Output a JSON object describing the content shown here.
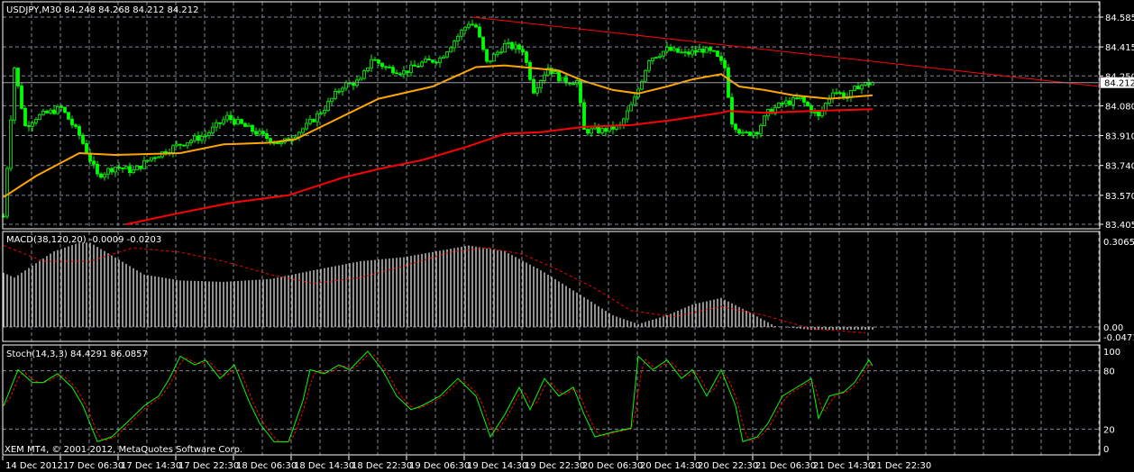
{
  "header": {
    "symbol_label": "USDJPY,M30  84.248 84.268 84.212 84.212",
    "macd_label": "MACD(38,120,20) -0.0009 -0.0203",
    "stoch_label": "Stoch(14,3,3) 84.4291 86.0857",
    "copyright": "XEM MT4, © 2001-2012, MetaQuotes Software Corp."
  },
  "colors": {
    "candle": "#00ff00",
    "ma_fast": "#ffa500",
    "ma_slow": "#ff0000",
    "trendline": "#ff0000",
    "macd_hist": "#c0c0c0",
    "macd_signal": "#ff0000",
    "stoch_main": "#00ff00",
    "stoch_signal": "#ff0000",
    "grid": "#7f8a99"
  },
  "chart_data": {
    "type": "line",
    "title": "USDJPY,M30",
    "x_unit": "bar index (30 min bars)",
    "time_ticks": [
      {
        "bar": 0,
        "label": "14 Dec 2012"
      },
      {
        "bar": 16,
        "label": "17 Dec 06:30"
      },
      {
        "bar": 32,
        "label": "17 Dec 14:30"
      },
      {
        "bar": 48,
        "label": "17 Dec 22:30"
      },
      {
        "bar": 64,
        "label": "18 Dec 06:30"
      },
      {
        "bar": 80,
        "label": "18 Dec 14:30"
      },
      {
        "bar": 96,
        "label": "18 Dec 22:30"
      },
      {
        "bar": 112,
        "label": "19 Dec 06:30"
      },
      {
        "bar": 128,
        "label": "19 Dec 14:30"
      },
      {
        "bar": 144,
        "label": "19 Dec 22:30"
      },
      {
        "bar": 160,
        "label": "20 Dec 06:30"
      },
      {
        "bar": 176,
        "label": "20 Dec 14:30"
      },
      {
        "bar": 192,
        "label": "20 Dec 22:30"
      },
      {
        "bar": 208,
        "label": "21 Dec 06:30"
      },
      {
        "bar": 224,
        "label": "21 Dec 14:30"
      },
      {
        "bar": 240,
        "label": "21 Dec 22:30"
      }
    ],
    "price": {
      "ylim": [
        83.405,
        84.585
      ],
      "ticks": [
        "84.585",
        "84.415",
        "84.250",
        "84.080",
        "83.910",
        "83.740",
        "83.570",
        "83.405"
      ],
      "current": "84.212",
      "close_series": [
        [
          0,
          83.451
        ],
        [
          3,
          84.298
        ],
        [
          6,
          83.964
        ],
        [
          9,
          84.015
        ],
        [
          16,
          84.067
        ],
        [
          21,
          83.913
        ],
        [
          26,
          83.682
        ],
        [
          31,
          83.733
        ],
        [
          36,
          83.708
        ],
        [
          41,
          83.785
        ],
        [
          49,
          83.862
        ],
        [
          56,
          83.913
        ],
        [
          62,
          84.015
        ],
        [
          69,
          83.939
        ],
        [
          74,
          83.887
        ],
        [
          77,
          83.862
        ],
        [
          84,
          83.964
        ],
        [
          89,
          84.067
        ],
        [
          94,
          84.195
        ],
        [
          99,
          84.221
        ],
        [
          102,
          84.349
        ],
        [
          106,
          84.298
        ],
        [
          111,
          84.272
        ],
        [
          116,
          84.323
        ],
        [
          121,
          84.349
        ],
        [
          125,
          84.452
        ],
        [
          129,
          84.554
        ],
        [
          131,
          84.529
        ],
        [
          134,
          84.323
        ],
        [
          139,
          84.426
        ],
        [
          144,
          84.4
        ],
        [
          147,
          84.169
        ],
        [
          151,
          84.298
        ],
        [
          155,
          84.221
        ],
        [
          159,
          84.221
        ],
        [
          161,
          83.939
        ],
        [
          166,
          83.939
        ],
        [
          171,
          83.964
        ],
        [
          175,
          84.118
        ],
        [
          179,
          84.349
        ],
        [
          184,
          84.4
        ],
        [
          189,
          84.375
        ],
        [
          194,
          84.4
        ],
        [
          197,
          84.375
        ],
        [
          200,
          84.298
        ],
        [
          202,
          83.99
        ],
        [
          205,
          83.913
        ],
        [
          209,
          83.939
        ],
        [
          212,
          84.041
        ],
        [
          216,
          84.092
        ],
        [
          221,
          84.118
        ],
        [
          226,
          84.015
        ],
        [
          230,
          84.169
        ],
        [
          234,
          84.128
        ],
        [
          237,
          84.195
        ],
        [
          241,
          84.212
        ]
      ],
      "ma_fast": [
        [
          0,
          83.56
        ],
        [
          9,
          83.68
        ],
        [
          21,
          83.81
        ],
        [
          31,
          83.8
        ],
        [
          49,
          83.81
        ],
        [
          61,
          83.86
        ],
        [
          74,
          83.87
        ],
        [
          81,
          83.89
        ],
        [
          91,
          83.99
        ],
        [
          104,
          84.12
        ],
        [
          119,
          84.19
        ],
        [
          131,
          84.3
        ],
        [
          139,
          84.31
        ],
        [
          144,
          84.3
        ],
        [
          154,
          84.28
        ],
        [
          161,
          84.22
        ],
        [
          169,
          84.17
        ],
        [
          176,
          84.15
        ],
        [
          184,
          84.19
        ],
        [
          191,
          84.23
        ],
        [
          199,
          84.26
        ],
        [
          204,
          84.19
        ],
        [
          211,
          84.17
        ],
        [
          219,
          84.14
        ],
        [
          229,
          84.12
        ],
        [
          235,
          84.13
        ],
        [
          241,
          84.14
        ]
      ],
      "ma_slow": [
        [
          34,
          83.405
        ],
        [
          49,
          83.47
        ],
        [
          64,
          83.53
        ],
        [
          79,
          83.57
        ],
        [
          94,
          83.67
        ],
        [
          104,
          83.72
        ],
        [
          116,
          83.77
        ],
        [
          129,
          83.85
        ],
        [
          139,
          83.92
        ],
        [
          149,
          83.93
        ],
        [
          161,
          83.96
        ],
        [
          174,
          83.97
        ],
        [
          186,
          84.0
        ],
        [
          199,
          84.04
        ],
        [
          201,
          84.05
        ],
        [
          211,
          84.04
        ],
        [
          224,
          84.05
        ],
        [
          241,
          84.06
        ]
      ],
      "trendline": [
        [
          130,
          84.585
        ],
        [
          304,
          84.19
        ]
      ]
    },
    "macd": {
      "ticks": [
        "0.3065",
        "0.00",
        "-0.0471"
      ],
      "ylim": [
        -0.0471,
        0.3065
      ],
      "histogram": [
        [
          0,
          0.186
        ],
        [
          3,
          0.17
        ],
        [
          14,
          0.26
        ],
        [
          21,
          0.29
        ],
        [
          24,
          0.29
        ],
        [
          39,
          0.18
        ],
        [
          49,
          0.16
        ],
        [
          61,
          0.155
        ],
        [
          74,
          0.165
        ],
        [
          86,
          0.195
        ],
        [
          99,
          0.226
        ],
        [
          111,
          0.24
        ],
        [
          129,
          0.28
        ],
        [
          139,
          0.26
        ],
        [
          149,
          0.195
        ],
        [
          159,
          0.118
        ],
        [
          169,
          0.04
        ],
        [
          176,
          0.01
        ],
        [
          184,
          0.04
        ],
        [
          191,
          0.077
        ],
        [
          199,
          0.1
        ],
        [
          206,
          0.056
        ],
        [
          214,
          0.003
        ],
        [
          224,
          -0.01
        ],
        [
          241,
          -0.009
        ]
      ],
      "signal": [
        [
          0,
          0.28
        ],
        [
          11,
          0.226
        ],
        [
          24,
          0.226
        ],
        [
          36,
          0.272
        ],
        [
          49,
          0.257
        ],
        [
          61,
          0.226
        ],
        [
          74,
          0.18
        ],
        [
          86,
          0.15
        ],
        [
          99,
          0.17
        ],
        [
          111,
          0.21
        ],
        [
          124,
          0.257
        ],
        [
          134,
          0.272
        ],
        [
          144,
          0.25
        ],
        [
          154,
          0.195
        ],
        [
          164,
          0.133
        ],
        [
          174,
          0.056
        ],
        [
          186,
          0.035
        ],
        [
          199,
          0.07
        ],
        [
          211,
          0.04
        ],
        [
          224,
          -0.006
        ],
        [
          239,
          -0.02
        ]
      ]
    },
    "stoch": {
      "ticks": [
        "100",
        "80",
        "20",
        "0"
      ],
      "ylim": [
        0,
        100
      ],
      "main": [
        [
          0,
          44
        ],
        [
          4,
          81
        ],
        [
          8,
          68
        ],
        [
          11,
          68
        ],
        [
          15,
          77
        ],
        [
          19,
          63
        ],
        [
          22,
          44
        ],
        [
          26,
          7
        ],
        [
          30,
          12
        ],
        [
          34,
          26
        ],
        [
          39,
          44
        ],
        [
          43,
          54
        ],
        [
          46,
          72
        ],
        [
          49,
          95
        ],
        [
          53,
          86
        ],
        [
          56,
          91
        ],
        [
          60,
          72
        ],
        [
          64,
          86
        ],
        [
          68,
          49
        ],
        [
          71,
          26
        ],
        [
          75,
          7
        ],
        [
          79,
          7
        ],
        [
          83,
          49
        ],
        [
          85,
          81
        ],
        [
          89,
          77
        ],
        [
          93,
          86
        ],
        [
          96,
          81
        ],
        [
          101,
          100
        ],
        [
          105,
          81
        ],
        [
          109,
          54
        ],
        [
          113,
          40
        ],
        [
          116,
          44
        ],
        [
          121,
          54
        ],
        [
          126,
          72
        ],
        [
          131,
          54
        ],
        [
          135,
          12
        ],
        [
          139,
          35
        ],
        [
          143,
          63
        ],
        [
          146,
          40
        ],
        [
          150,
          72
        ],
        [
          154,
          54
        ],
        [
          158,
          63
        ],
        [
          161,
          35
        ],
        [
          164,
          12
        ],
        [
          169,
          17
        ],
        [
          174,
          21
        ],
        [
          176,
          95
        ],
        [
          180,
          81
        ],
        [
          184,
          91
        ],
        [
          188,
          72
        ],
        [
          191,
          81
        ],
        [
          195,
          54
        ],
        [
          199,
          81
        ],
        [
          203,
          44
        ],
        [
          205,
          7
        ],
        [
          209,
          12
        ],
        [
          212,
          26
        ],
        [
          216,
          54
        ],
        [
          220,
          63
        ],
        [
          224,
          72
        ],
        [
          226,
          31
        ],
        [
          229,
          54
        ],
        [
          233,
          58
        ],
        [
          236,
          68
        ],
        [
          240,
          91
        ],
        [
          241,
          85
        ]
      ],
      "signal_smoothing": 3
    }
  }
}
